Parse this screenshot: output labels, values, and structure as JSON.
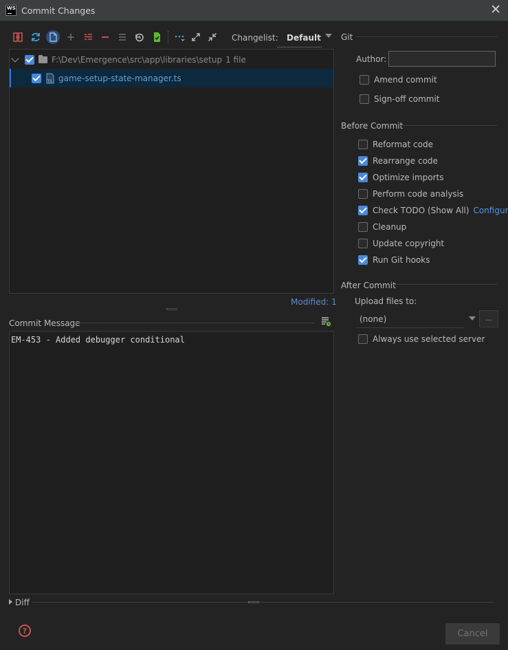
{
  "window": {
    "title": "Commit Changes",
    "app_logo": "WS"
  },
  "toolbar": {
    "icons": [
      "show-diff-icon",
      "refresh-icon",
      "file-icon",
      "add-icon",
      "group-by-icon",
      "remove-icon",
      "list-icon",
      "rollback-icon",
      "shelve-icon",
      "more-icon",
      "expand-all-icon",
      "collapse-all-icon"
    ],
    "changelist_label": "Changelist:",
    "changelist_value": "Default"
  },
  "tree": {
    "folder": {
      "path": "F:\\Dev\\Emergence\\src\\app\\libraries\\setup",
      "count": "1 file",
      "checked": true
    },
    "file": {
      "name": "game-setup-state-manager.ts",
      "checked": true
    }
  },
  "status": {
    "modified": "Modified: 1"
  },
  "commit_message": {
    "label": "Commit Message",
    "text": "EM-453 - Added debugger conditional"
  },
  "diff": {
    "label": "Diff"
  },
  "git": {
    "section": "Git",
    "author_label": "Author:",
    "author_value": "",
    "options": [
      {
        "label": "Amend commit",
        "checked": false
      },
      {
        "label": "Sign-off commit",
        "checked": false
      }
    ]
  },
  "before_commit": {
    "section": "Before Commit",
    "options": [
      {
        "label": "Reformat code",
        "checked": false
      },
      {
        "label": "Rearrange code",
        "checked": true
      },
      {
        "label": "Optimize imports",
        "checked": true
      },
      {
        "label": "Perform code analysis",
        "checked": false
      },
      {
        "label": "Check TODO (Show All)",
        "checked": true,
        "link": "Configure"
      },
      {
        "label": "Cleanup",
        "checked": false
      },
      {
        "label": "Update copyright",
        "checked": false
      },
      {
        "label": "Run Git hooks",
        "checked": true
      }
    ]
  },
  "after_commit": {
    "section": "After Commit",
    "upload_label": "Upload files to:",
    "upload_value": "(none)",
    "browse_label": "...",
    "always_use": {
      "label": "Always use selected server",
      "checked": false
    }
  },
  "footer": {
    "help_label": "?",
    "cancel_label": "Cancel"
  },
  "colors": {
    "accent": "#4a88d8",
    "link": "#5394ec",
    "error_red": "#c75450",
    "selection": "#0d293e"
  }
}
